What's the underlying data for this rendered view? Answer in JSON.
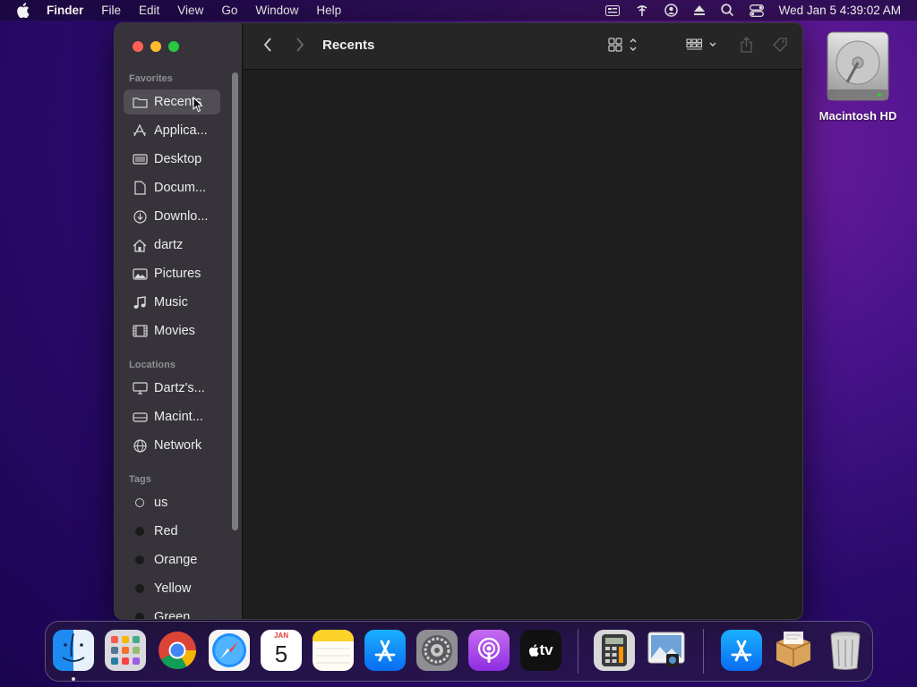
{
  "menubar": {
    "app_name": "Finder",
    "items": [
      "File",
      "Edit",
      "View",
      "Go",
      "Window",
      "Help"
    ],
    "clock": "Wed Jan 5  4:39:02 AM"
  },
  "desktop": {
    "icons": [
      {
        "label": "Macintosh HD"
      }
    ]
  },
  "finder": {
    "title": "Recents",
    "sidebar": {
      "favorites_title": "Favorites",
      "favorites": [
        {
          "label": "Recents",
          "icon": "clock-folder-icon"
        },
        {
          "label": "Applica...",
          "icon": "applications-icon"
        },
        {
          "label": "Desktop",
          "icon": "desktop-icon"
        },
        {
          "label": "Docum...",
          "icon": "document-icon"
        },
        {
          "label": "Downlo...",
          "icon": "download-icon"
        },
        {
          "label": "dartz",
          "icon": "home-icon"
        },
        {
          "label": "Pictures",
          "icon": "pictures-icon"
        },
        {
          "label": "Music",
          "icon": "music-icon"
        },
        {
          "label": "Movies",
          "icon": "movies-icon"
        }
      ],
      "locations_title": "Locations",
      "locations": [
        {
          "label": "Dartz's...",
          "icon": "computer-icon"
        },
        {
          "label": "Macint...",
          "icon": "drive-icon"
        },
        {
          "label": "Network",
          "icon": "network-icon"
        }
      ],
      "tags_title": "Tags",
      "tags": [
        {
          "label": "us"
        },
        {
          "label": "Red"
        },
        {
          "label": "Orange"
        },
        {
          "label": "Yellow"
        },
        {
          "label": "Green"
        }
      ]
    }
  },
  "dock": {
    "calendar_month": "JAN",
    "calendar_day": "5",
    "tv_label": "tv"
  }
}
